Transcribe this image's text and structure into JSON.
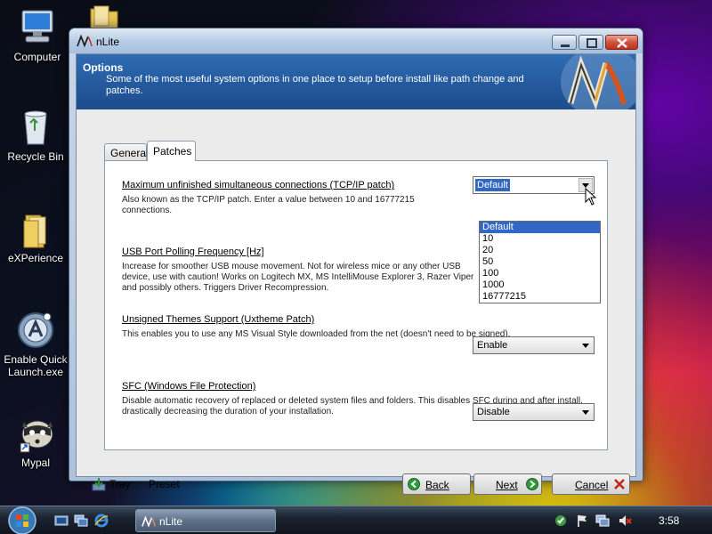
{
  "desktop": {
    "icons": [
      {
        "label": "Computer"
      },
      {
        "label": "Recycle Bin"
      },
      {
        "label": "eXPerience"
      },
      {
        "label": "Enable Quick Launch.exe"
      },
      {
        "label": "Mypal"
      }
    ]
  },
  "window": {
    "title": "nLite",
    "header": {
      "title": "Options",
      "description": "Some of the most useful system options in one place to setup before install like path change and patches."
    },
    "tabs": [
      {
        "label": "General",
        "active": false
      },
      {
        "label": "Patches",
        "active": true
      }
    ],
    "options": [
      {
        "title": "Maximum unfinished simultaneous connections (TCP/IP patch)",
        "description": "Also known as the TCP/IP patch. Enter a value between 10 and 16777215 connections.",
        "value": "Default"
      },
      {
        "title": "USB Port Polling Frequency [Hz]",
        "description": "Increase for smoother USB mouse movement. Not for wireless mice or any other USB device, use with caution! Works on Logitech MX, MS IntelliMouse Explorer 3, Razer Viper and possibly others. Triggers Driver Recompression."
      },
      {
        "title": "Unsigned Themes Support (Uxtheme Patch)",
        "description": "This enables you to use any MS Visual Style downloaded from the net (doesn't need to be signed).",
        "value": "Enable"
      },
      {
        "title": "SFC (Windows File Protection)",
        "description": "Disable automatic recovery of replaced or deleted system files and folders. This disables SFC during and after install, drastically decreasing the duration of your installation.",
        "value": "Disable"
      }
    ],
    "dropdown_options": [
      "Default",
      "10",
      "20",
      "50",
      "100",
      "1000",
      "16777215"
    ],
    "footer": {
      "tray": "Tray",
      "preset": "Preset",
      "back": "Back",
      "next": "Next",
      "cancel": "Cancel"
    }
  },
  "taskbar": {
    "task_label": "nLite",
    "clock": "3:58"
  },
  "colors": {
    "header_blue": "#1c4c8c",
    "selection_blue": "#3168c5"
  }
}
